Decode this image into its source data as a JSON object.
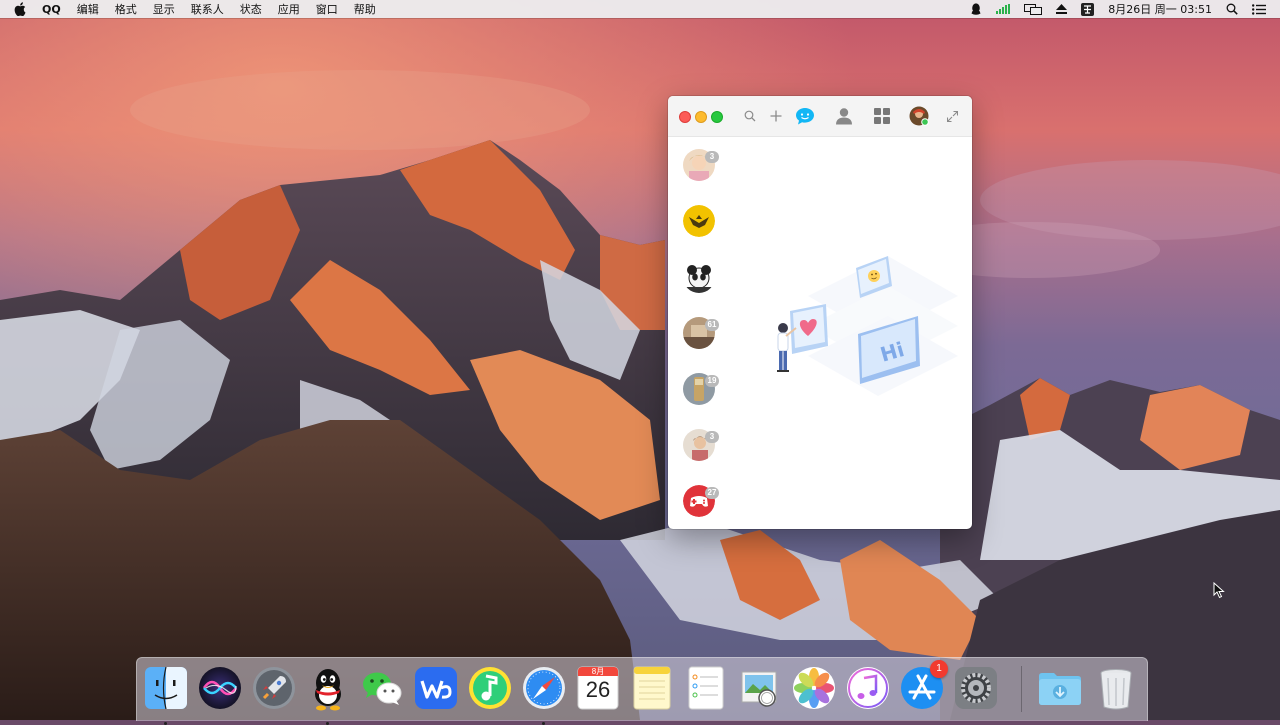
{
  "menubar": {
    "app_name": "QQ",
    "menus": [
      "编辑",
      "格式",
      "显示",
      "联系人",
      "状态",
      "应用",
      "窗口",
      "帮助"
    ],
    "clock": "8月26日 周一  03:51"
  },
  "qq_window": {
    "conversations": [
      {
        "name": "conversation-1",
        "badge": "3",
        "avatar_color": "#e9c9a6"
      },
      {
        "name": "conversation-2",
        "badge": "",
        "avatar_color": "#f2c200"
      },
      {
        "name": "conversation-3",
        "badge": "",
        "avatar_color": "#222222"
      },
      {
        "name": "conversation-4",
        "badge": "61",
        "avatar_color": "#9a7d60"
      },
      {
        "name": "conversation-5",
        "badge": "19",
        "avatar_color": "#7a8a96"
      },
      {
        "name": "conversation-6",
        "badge": "3",
        "avatar_color": "#d7c8b8"
      },
      {
        "name": "conversation-7",
        "badge": "27",
        "avatar_color": "#e0333a"
      }
    ],
    "illustration_text": "Hi"
  },
  "dock": {
    "apps": [
      "Finder",
      "Siri",
      "Launchpad",
      "QQ",
      "WeChat",
      "WPS",
      "QQ Music",
      "Safari",
      "Calendar",
      "Notes",
      "Reminders",
      "Preview",
      "Photos",
      "iTunes",
      "App Store",
      "System Preferences",
      "Downloads",
      "Trash"
    ],
    "calendar_month": "8月",
    "calendar_day": "26",
    "appstore_badge": "1"
  },
  "colors": {
    "accent_blue": "#12b7f5",
    "badge_gray": "#b9b9b9",
    "dock_badge_red": "#f23a2f"
  }
}
